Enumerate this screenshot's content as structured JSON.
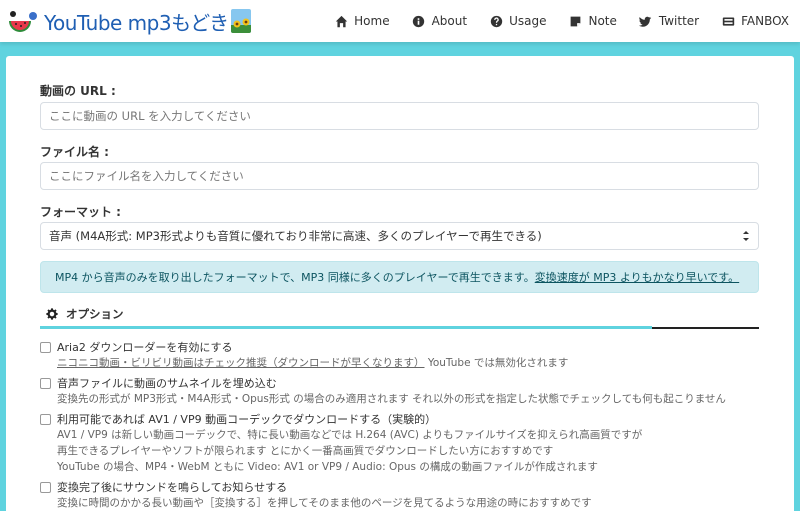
{
  "brand": {
    "logo_text": "YouTube mp3もどき",
    "accent": "#5fd3df"
  },
  "nav": [
    {
      "label": "Home",
      "icon": "home-icon"
    },
    {
      "label": "About",
      "icon": "info-circle-icon"
    },
    {
      "label": "Usage",
      "icon": "question-circle-icon"
    },
    {
      "label": "Note",
      "icon": "note-icon"
    },
    {
      "label": "Twitter",
      "icon": "twitter-icon"
    },
    {
      "label": "FANBOX",
      "icon": "fanbox-icon"
    }
  ],
  "form": {
    "url_label": "動画の URL :",
    "url_placeholder": "ここに動画の URL を入力してください",
    "filename_label": "ファイル名 :",
    "filename_placeholder": "ここにファイル名を入力してください",
    "format_label": "フォーマット :",
    "format_selected": "音声 (M4A形式: MP3形式よりも音質に優れており非常に高速、多くのプレイヤーで再生できる)"
  },
  "info": {
    "text": "MP4 から音声のみを取り出したフォーマットで、MP3 同様に多くのプレイヤーで再生できます。",
    "link": "変換速度が MP3 よりもかなり早いです。",
    "bg": "#d1ecf1"
  },
  "options_tab": {
    "label": "オプション",
    "icon": "gear-icon"
  },
  "options": [
    {
      "title": "Aria2 ダウンローダーを有効にする",
      "desc": [
        {
          "underlined": "ニコニコ動画・ビリビリ動画はチェック推奨（ダウンロードが早くなります）",
          "rest": " YouTube では無効化されます"
        }
      ]
    },
    {
      "title": "音声ファイルに動画のサムネイルを埋め込む",
      "desc": [
        {
          "underlined": "",
          "rest": "変換先の形式が MP3形式・M4A形式・Opus形式 の場合のみ適用されます それ以外の形式を指定した状態でチェックしても何も起こりません"
        }
      ]
    },
    {
      "title": "利用可能であれば AV1 / VP9 動画コーデックでダウンロードする（実験的）",
      "desc": [
        {
          "underlined": "",
          "rest": "AV1 / VP9 は新しい動画コーデックで、特に長い動画などでは H.264 (AVC) よりもファイルサイズを抑えられ高画質ですが"
        },
        {
          "underlined": "",
          "rest": "再生できるプレイヤーやソフトが限られます とにかく一番高画質でダウンロードしたい方におすすめです"
        },
        {
          "underlined": "",
          "rest": "YouTube の場合、MP4・WebM ともに Video: AV1 or VP9 / Audio: Opus の構成の動画ファイルが作成されます"
        }
      ]
    },
    {
      "title": "変換完了後にサウンドを鳴らしてお知らせする",
      "desc": [
        {
          "underlined": "",
          "rest": "変換に時間のかかる長い動画や［変換する］を押してそのまま他のページを見てるような用途の時におすすめです"
        }
      ]
    }
  ]
}
